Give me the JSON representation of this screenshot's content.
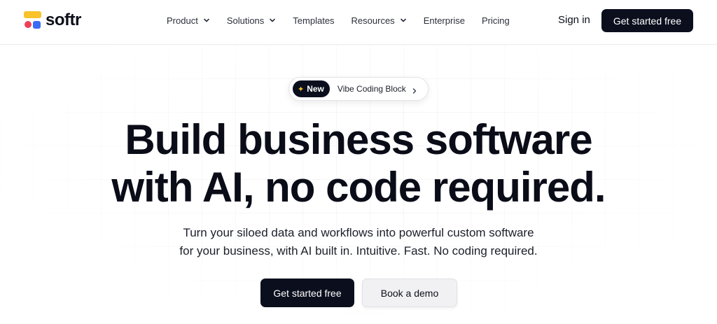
{
  "header": {
    "logo_text": "softr",
    "nav": [
      {
        "label": "Product",
        "has_dropdown": true
      },
      {
        "label": "Solutions",
        "has_dropdown": true
      },
      {
        "label": "Templates",
        "has_dropdown": false
      },
      {
        "label": "Resources",
        "has_dropdown": true
      },
      {
        "label": "Enterprise",
        "has_dropdown": false
      },
      {
        "label": "Pricing",
        "has_dropdown": false
      }
    ],
    "signin_label": "Sign in",
    "cta_label": "Get started free"
  },
  "hero": {
    "badge": {
      "pill_label": "New",
      "text": "Vibe Coding Block"
    },
    "headline_line1": "Build business software",
    "headline_line2": "with AI, no code required.",
    "subtitle_line1": "Turn your siloed data and workflows into powerful custom software",
    "subtitle_line2": "for your business, with AI built in. Intuitive. Fast. No coding required.",
    "primary_button": "Get started free",
    "secondary_button": "Book a demo"
  },
  "colors": {
    "brand_dark": "#0b0f1d",
    "logo_yellow": "#f9c32c",
    "logo_red": "#ef4057",
    "logo_blue": "#3a6cf4"
  }
}
